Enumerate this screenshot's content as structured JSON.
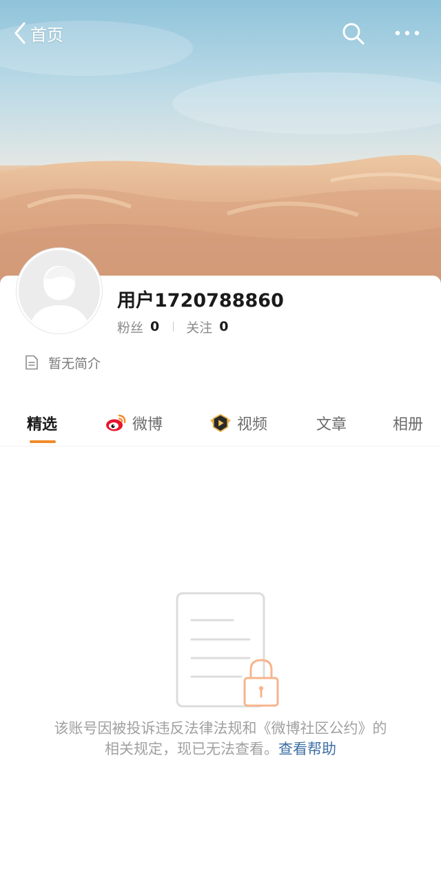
{
  "nav": {
    "back_label": "首页"
  },
  "profile": {
    "username": "用户1720788860",
    "fans_label": "粉丝",
    "fans_count": "0",
    "following_label": "关注",
    "following_count": "0",
    "bio": "暂无简介"
  },
  "tabs": [
    {
      "label": "精选",
      "active": true
    },
    {
      "label": "微博",
      "icon": "weibo-logo-icon"
    },
    {
      "label": "视频",
      "icon": "video-badge-icon"
    },
    {
      "label": "文章"
    },
    {
      "label": "相册"
    }
  ],
  "empty_state": {
    "icon": "locked-document-icon",
    "message": "该账号因被投诉违反法律法规和《微博社区公约》的相关规定，现已无法查看。",
    "help_link": "查看帮助"
  },
  "colors": {
    "accent": "#f28a2a",
    "link": "#3e6fa4",
    "muted_text": "#a0a0a0"
  }
}
